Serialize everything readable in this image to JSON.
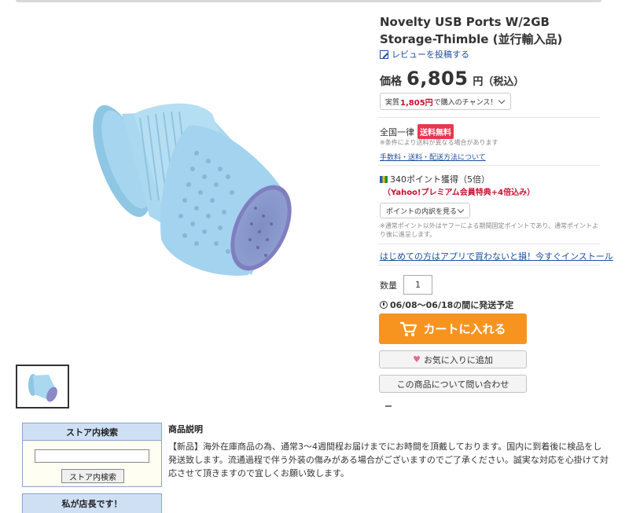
{
  "product": {
    "title": "Novelty USB Ports W/2GB Storage-Thimble (並行輸入品)",
    "review_link": "レビューを投稿する",
    "price_label": "価格",
    "price_value": "6,805",
    "price_unit": "円（税込）",
    "chance": {
      "prefix": "実質",
      "amount": "1,805円",
      "suffix": "で購入のチャンス！"
    }
  },
  "shipping": {
    "label": "全国一律",
    "badge": "送料無料",
    "note": "※条件により送料が異なる場合があります",
    "link": "手数料・送料・配送方法について"
  },
  "points": {
    "earn": "340ポイント獲得（5倍）",
    "premium": "（Yahoo!プレミアム会員特典+4倍込み）",
    "breakdown_button": "ポイントの内訳を見る",
    "note": "※通常ポイント以外はヤフーによる期間固定ポイントであり、通常ポイントより後に進呈します。"
  },
  "app_link": "はじめての方はアプリで買わないと損！今すぐインストール",
  "quantity": {
    "label": "数量",
    "value": "1"
  },
  "delivery": "06/08〜06/18の間に発送予定",
  "buttons": {
    "cart": "カートに入れる",
    "favorite": "お気に入りに追加",
    "inquiry": "この商品について問い合わせ"
  },
  "store_search": {
    "heading": "ストア内検索",
    "button": "ストア内検索",
    "input_value": ""
  },
  "manager_box": "私が店長です！",
  "description": {
    "heading": "商品説明",
    "body": "【新品】海外在庫商品の為、通常3〜4週間程お届けまでにお時間を頂戴しております。国内に到着後に検品をし発送致します。流通過程で伴う外装の傷みがある場合がございますのでご了承ください。誠実な対応を心掛けて対応させて頂きますので宜しくお願い致します。"
  },
  "colors": {
    "accent_orange": "#f79420",
    "link_blue": "#1d4fa0",
    "price_red": "#c8102e",
    "badge_pink": "#e8384f",
    "thimble_blue": "#9ed0ea"
  }
}
